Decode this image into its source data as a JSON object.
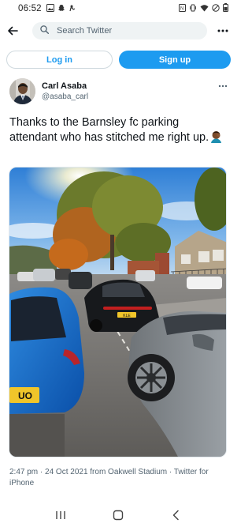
{
  "status_bar": {
    "time": "06:52",
    "left_icons": [
      "image-icon",
      "snapchat-icon",
      "notification-icon"
    ],
    "right_icons": [
      "nfc-icon",
      "vibrate-icon",
      "wifi-icon",
      "do-not-disturb-icon",
      "battery-icon"
    ]
  },
  "top_bar": {
    "back_icon": "arrow-left-icon",
    "search_placeholder": "Search Twitter",
    "more_icon": "more-horizontal-icon"
  },
  "auth": {
    "login_label": "Log in",
    "signup_label": "Sign up"
  },
  "tweet": {
    "author": {
      "display_name": "Carl Asaba",
      "handle": "@asaba_carl"
    },
    "text": "Thanks to the Barnsley fc parking attendant who has stitched me right up.",
    "emoji": "facepalm-emoji",
    "meta": "2:47 pm · 24 Oct 2021 from Oakwell Stadium · Twitter for iPhone",
    "image": {
      "plate": "UO",
      "plate_right": "KLE"
    }
  },
  "nav_bar": {
    "icons": [
      "recent-apps-icon",
      "home-icon",
      "back-icon"
    ]
  },
  "colors": {
    "accent": "#1d9bf0",
    "text_primary": "#0f1419",
    "text_secondary": "#536471",
    "search_bg": "#eff3f4"
  }
}
